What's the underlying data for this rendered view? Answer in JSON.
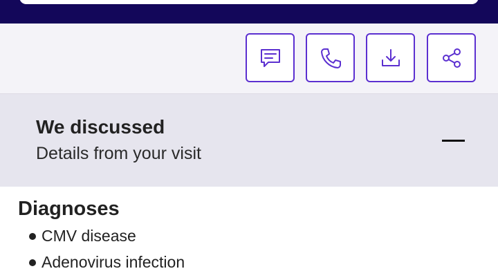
{
  "toolbar": {
    "actions": [
      {
        "icon": "message-icon"
      },
      {
        "icon": "phone-icon"
      },
      {
        "icon": "download-icon"
      },
      {
        "icon": "share-icon"
      }
    ],
    "accent_color": "#5b2fd0"
  },
  "header": {
    "bar_color": "#13075a"
  },
  "section": {
    "title": "We discussed",
    "subtitle": "Details from your visit",
    "toggle_icon": "minus-icon",
    "expanded": true
  },
  "diagnoses": {
    "heading": "Diagnoses",
    "items": [
      "CMV disease",
      "Adenovirus infection"
    ]
  }
}
